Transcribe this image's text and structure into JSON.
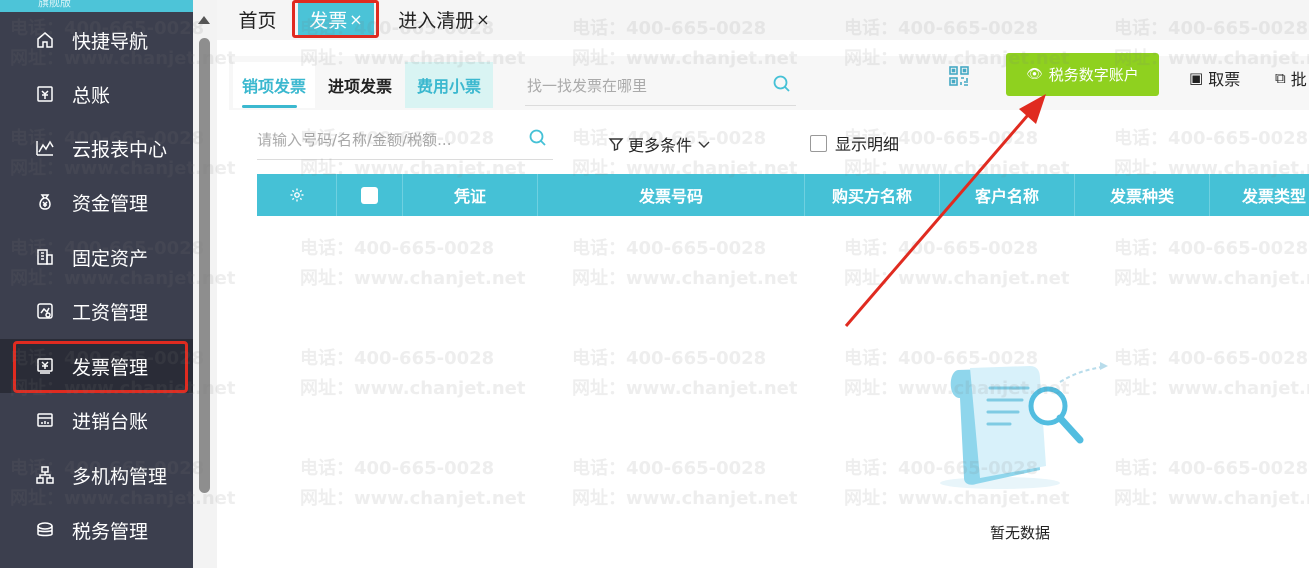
{
  "sidebar": {
    "brand": "旗舰版",
    "items": [
      {
        "label": "快捷导航",
        "icon": "home-icon"
      },
      {
        "label": "总账",
        "icon": "ledger-icon"
      },
      {
        "label": "云报表中心",
        "icon": "line-chart-icon"
      },
      {
        "label": "资金管理",
        "icon": "money-bag-icon"
      },
      {
        "label": "固定资产",
        "icon": "building-icon"
      },
      {
        "label": "工资管理",
        "icon": "payroll-icon"
      },
      {
        "label": "发票管理",
        "icon": "invoice-icon",
        "active": true
      },
      {
        "label": "进销台账",
        "icon": "inventory-icon"
      },
      {
        "label": "多机构管理",
        "icon": "org-tree-icon"
      },
      {
        "label": "税务管理",
        "icon": "tax-icon"
      }
    ]
  },
  "tabs": [
    {
      "label": "首页",
      "closable": false
    },
    {
      "label": "发票",
      "closable": true,
      "active": true
    },
    {
      "label": "进入清册",
      "closable": true
    }
  ],
  "tab_close_glyph": "×",
  "subtabs": [
    "销项发票",
    "进项发票",
    "费用小票"
  ],
  "find_placeholder": "找一找发票在哪里",
  "toolbar": {
    "tax_account_button": "税务数字账户",
    "fetch_label": "取票",
    "batch_label": "批"
  },
  "filter": {
    "placeholder": "请输入号码/名称/金额/税额...",
    "more_conditions": "更多条件",
    "show_detail": "显示明细"
  },
  "table": {
    "columns": [
      "凭证",
      "发票号码",
      "购买方名称",
      "客户名称",
      "发票种类",
      "发票类型"
    ]
  },
  "empty_text": "暂无数据",
  "watermark": {
    "phone": "电话：400-665-0028",
    "site": "网址：www.chanjet.net"
  },
  "colors": {
    "accent": "#45c1d6",
    "sidebar_bg": "#3c3f4e",
    "tax_button": "#8fd11f",
    "annotation_red": "#e02b20"
  }
}
